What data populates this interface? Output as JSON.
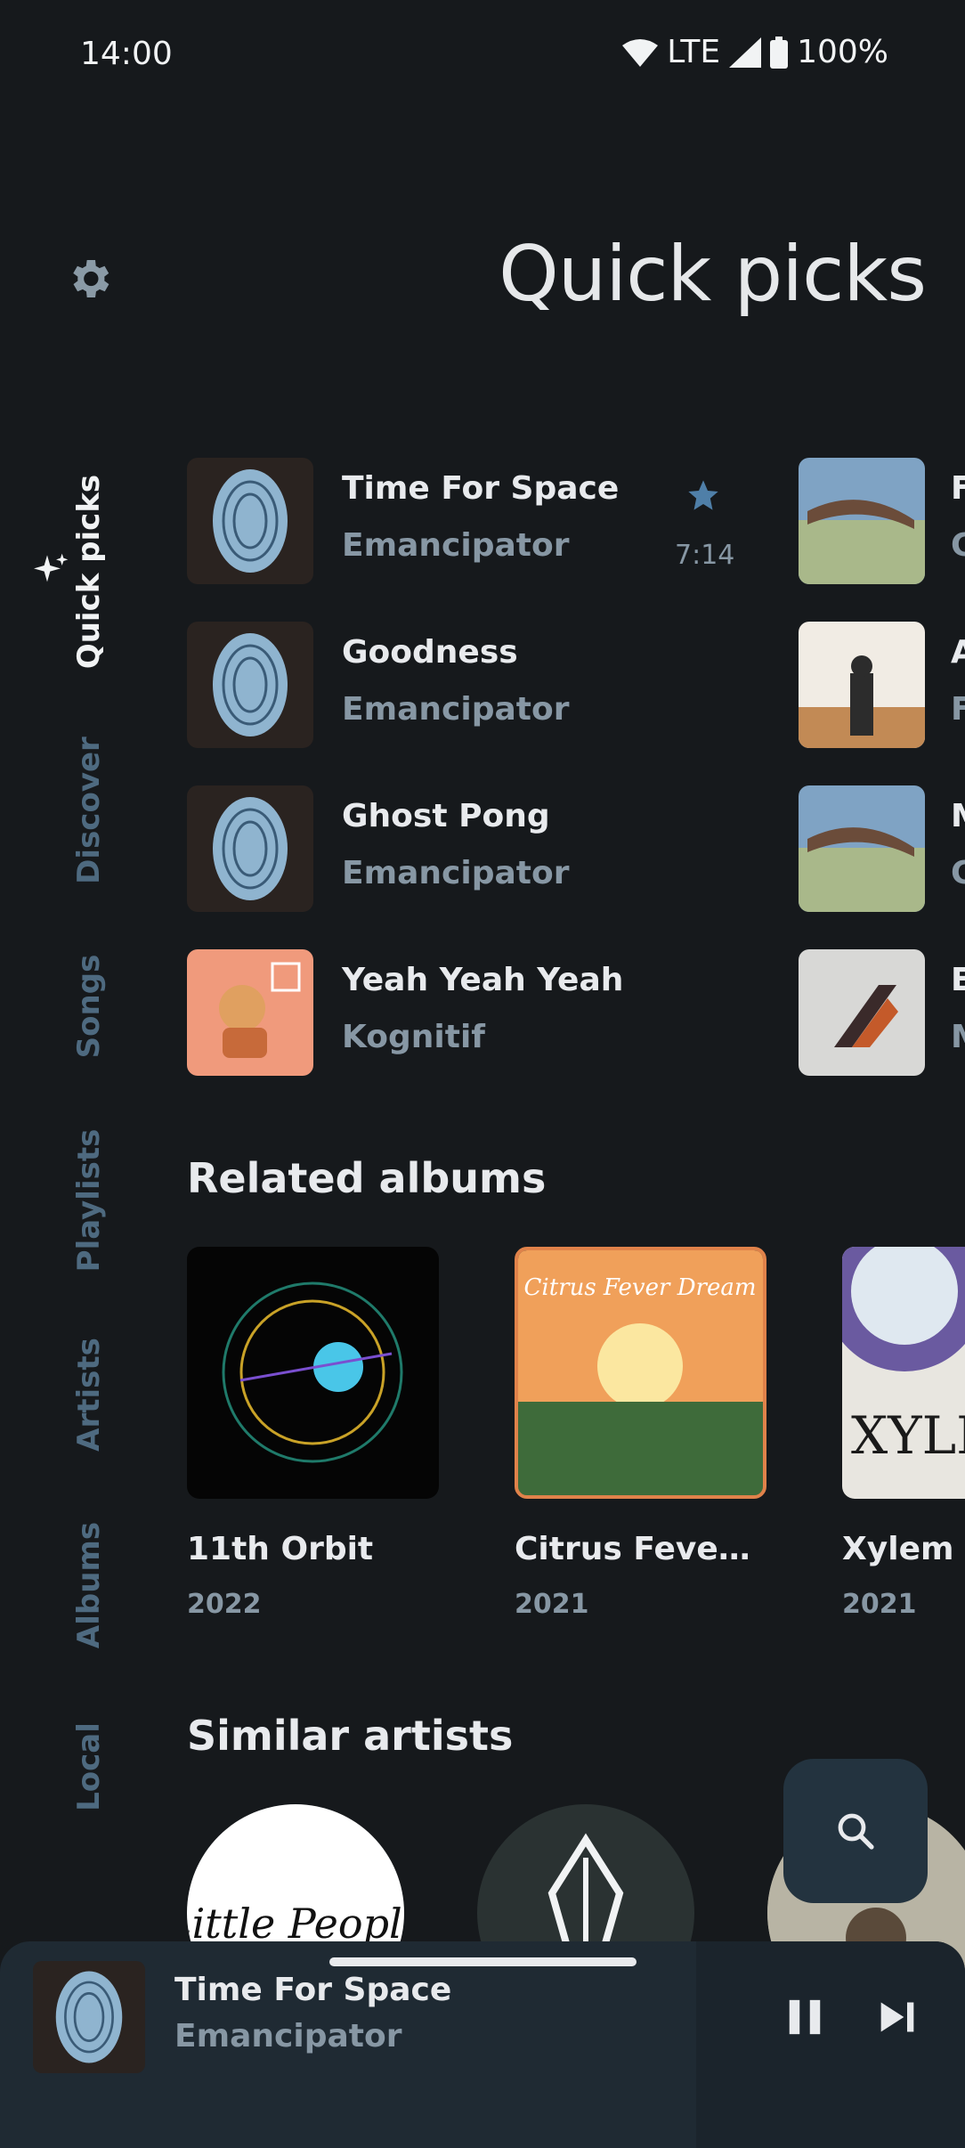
{
  "status_bar": {
    "time": "14:00",
    "network": "LTE",
    "battery": "100%"
  },
  "header": {
    "title": "Quick picks"
  },
  "nav": {
    "items": [
      {
        "label": "Quick picks",
        "active": true
      },
      {
        "label": "Discover",
        "active": false
      },
      {
        "label": "Songs",
        "active": false
      },
      {
        "label": "Playlists",
        "active": false
      },
      {
        "label": "Artists",
        "active": false
      },
      {
        "label": "Albums",
        "active": false
      },
      {
        "label": "Local",
        "active": false
      }
    ]
  },
  "quick_picks": [
    {
      "title": "Time For Space",
      "artist": "Emancipator",
      "duration": "7:14",
      "favorite": true
    },
    {
      "title": "Goodness",
      "artist": "Emancipator"
    },
    {
      "title": "Ghost Pong",
      "artist": "Emancipator"
    },
    {
      "title": "Yeah Yeah Yeah",
      "artist": "Kognitif"
    }
  ],
  "quick_picks_peek": [
    {
      "title_initial": "F",
      "artist_initial": "C"
    },
    {
      "title_initial": "A",
      "artist_initial": "F"
    },
    {
      "title_initial": "M",
      "artist_initial": "C"
    },
    {
      "title_initial": "E",
      "artist_initial": "M"
    }
  ],
  "related_albums": {
    "heading": "Related albums",
    "items": [
      {
        "name": "11th Orbit",
        "year": "2022"
      },
      {
        "name": "Citrus Fever D...",
        "year": "2021",
        "cover_text": "Citrus Fever Dream"
      },
      {
        "name": "Xylem",
        "year": "2021",
        "cover_text": "XYLEM"
      }
    ]
  },
  "similar_artists": {
    "heading": "Similar artists",
    "items": [
      {
        "cover_text": "Little People"
      },
      {
        "cover_text": ""
      },
      {
        "cover_text": ""
      }
    ]
  },
  "mini_player": {
    "title": "Time For Space",
    "artist": "Emancipator"
  },
  "colors": {
    "background": "#16191c",
    "accent": "#4f7fa8",
    "inactive_nav": "#4e6a80",
    "player": "#1f2a33"
  }
}
